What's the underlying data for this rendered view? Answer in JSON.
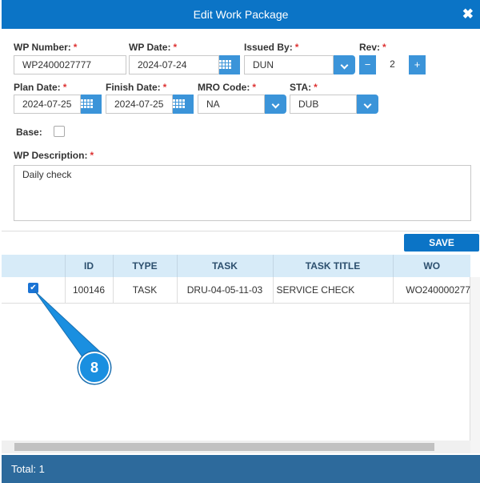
{
  "dialog": {
    "title": "Edit Work Package",
    "close_icon": "close-icon"
  },
  "form": {
    "wp_number": {
      "label": "WP Number:",
      "value": "WP2400027777"
    },
    "wp_date": {
      "label": "WP Date:",
      "value": "2024-07-24"
    },
    "issued_by": {
      "label": "Issued By:",
      "value": "DUN"
    },
    "rev": {
      "label": "Rev:",
      "value": "2",
      "minus": "−",
      "plus": "+"
    },
    "plan_date": {
      "label": "Plan Date:",
      "value": "2024-07-25"
    },
    "finish_date": {
      "label": "Finish Date:",
      "value": "2024-07-25"
    },
    "mro_code": {
      "label": "MRO Code:",
      "value": "NA"
    },
    "sta": {
      "label": "STA:",
      "value": "DUB"
    },
    "base": {
      "label": "Base:",
      "checked": false
    },
    "description": {
      "label": "WP Description:",
      "value": "Daily check"
    },
    "required_mark": "*"
  },
  "save_label": "SAVE",
  "table": {
    "columns": [
      "ID",
      "TYPE",
      "TASK",
      "TASK TITLE",
      "WO"
    ],
    "rows": [
      {
        "checked": true,
        "id": "100146",
        "type": "TASK",
        "task": "DRU-04-05-11-03",
        "title": "SERVICE CHECK",
        "wo": "WO240000277"
      }
    ]
  },
  "footer": {
    "total": "Total: 1"
  },
  "annotation": {
    "step": "8"
  }
}
